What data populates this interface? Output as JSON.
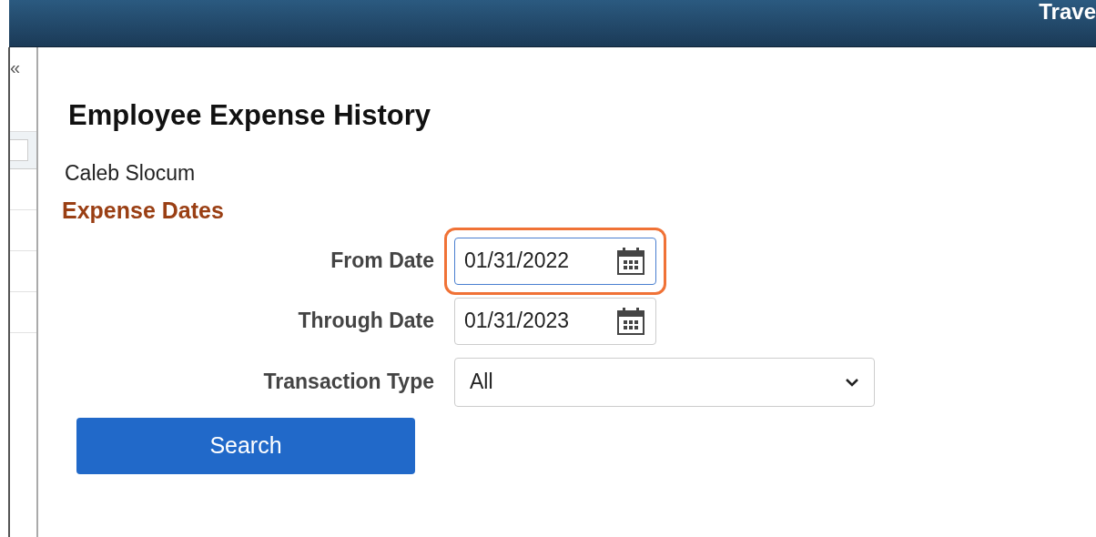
{
  "header": {
    "title": "Trave"
  },
  "sidebar": {
    "collapse": "«"
  },
  "page": {
    "title": "Employee Expense History",
    "employee": "Caleb Slocum",
    "section": "Expense Dates"
  },
  "fields": [
    {
      "kind": "date",
      "label": "From Date",
      "value": "01/31/2022",
      "focused": true
    },
    {
      "kind": "date",
      "label": "Through Date",
      "value": "01/31/2023",
      "focused": false
    },
    {
      "kind": "select",
      "label": "Transaction Type",
      "value": "All",
      "focused": false
    }
  ],
  "button": "Search"
}
